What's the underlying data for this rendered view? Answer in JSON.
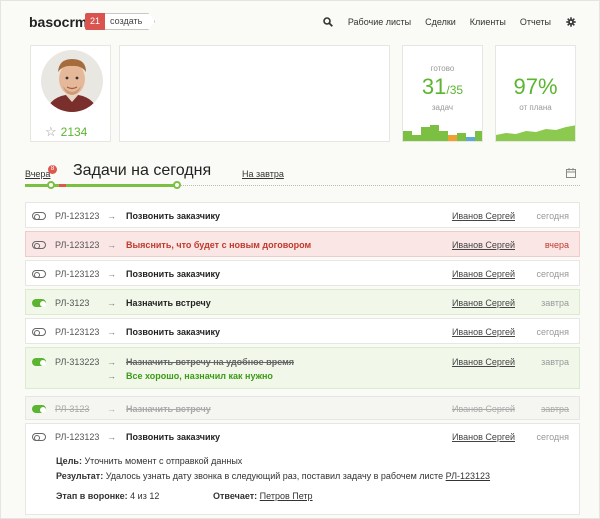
{
  "app": {
    "logo": "basocrm",
    "create_count": "21",
    "create_label": "создать"
  },
  "nav": {
    "items": [
      "Рабочие листы",
      "Сделки",
      "Клиенты",
      "Отчеты"
    ]
  },
  "profile": {
    "rating": "2134"
  },
  "stats": {
    "done_caption": "готово",
    "done_value": "31",
    "done_total": "/35",
    "done_sub": "задач",
    "plan_value": "97%",
    "plan_sub": "от плана"
  },
  "days": {
    "prev": "Вчера",
    "prev_badge": "8",
    "title": "Задачи на сегодня",
    "next": "На завтра"
  },
  "tasks": [
    {
      "code": "РЛ-123123",
      "title": "Позвонить заказчику",
      "owner": "Иванов Сергей",
      "when": "сегодня"
    },
    {
      "code": "РЛ-123123",
      "title": "Выяснить, что будет с новым договором",
      "owner": "Иванов Сергей",
      "when": "вчера"
    },
    {
      "code": "РЛ-123123",
      "title": "Позвонить заказчику",
      "owner": "Иванов Сергей",
      "when": "сегодня"
    },
    {
      "code": "РЛ-3123",
      "title": "Назначить встречу",
      "owner": "Иванов Сергей",
      "when": "завтра"
    },
    {
      "code": "РЛ-123123",
      "title": "Позвонить заказчику",
      "owner": "Иванов Сергей",
      "when": "сегодня"
    },
    {
      "code": "РЛ-313223",
      "title": "Назначить встречу на удобное время",
      "result": "Все хорошо, назначил как нужно",
      "owner": "Иванов Сергей",
      "when": "завтра"
    },
    {
      "code": "РЛ-3123",
      "title": "Назначить встречу",
      "owner": "Иванов Сергей",
      "when": "завтра"
    },
    {
      "code": "РЛ-123123",
      "title": "Позвонить заказчику",
      "owner": "Иванов Сергей",
      "when": "сегодня",
      "goal_label": "Цель:",
      "goal": "Уточнить момент с отправкой данных",
      "result_label": "Результат:",
      "result": "Удалось узнать дату звонка в следующий раз, поставил задачу в рабочем листе",
      "result_link": "РЛ-123123",
      "stage_label": "Этап в воронке:",
      "stage": "4 из 12",
      "resp_label": "Отвечает:",
      "resp": "Петров Петр"
    }
  ],
  "colors": {
    "accent": "#5cb531",
    "alert": "#d9534f"
  }
}
